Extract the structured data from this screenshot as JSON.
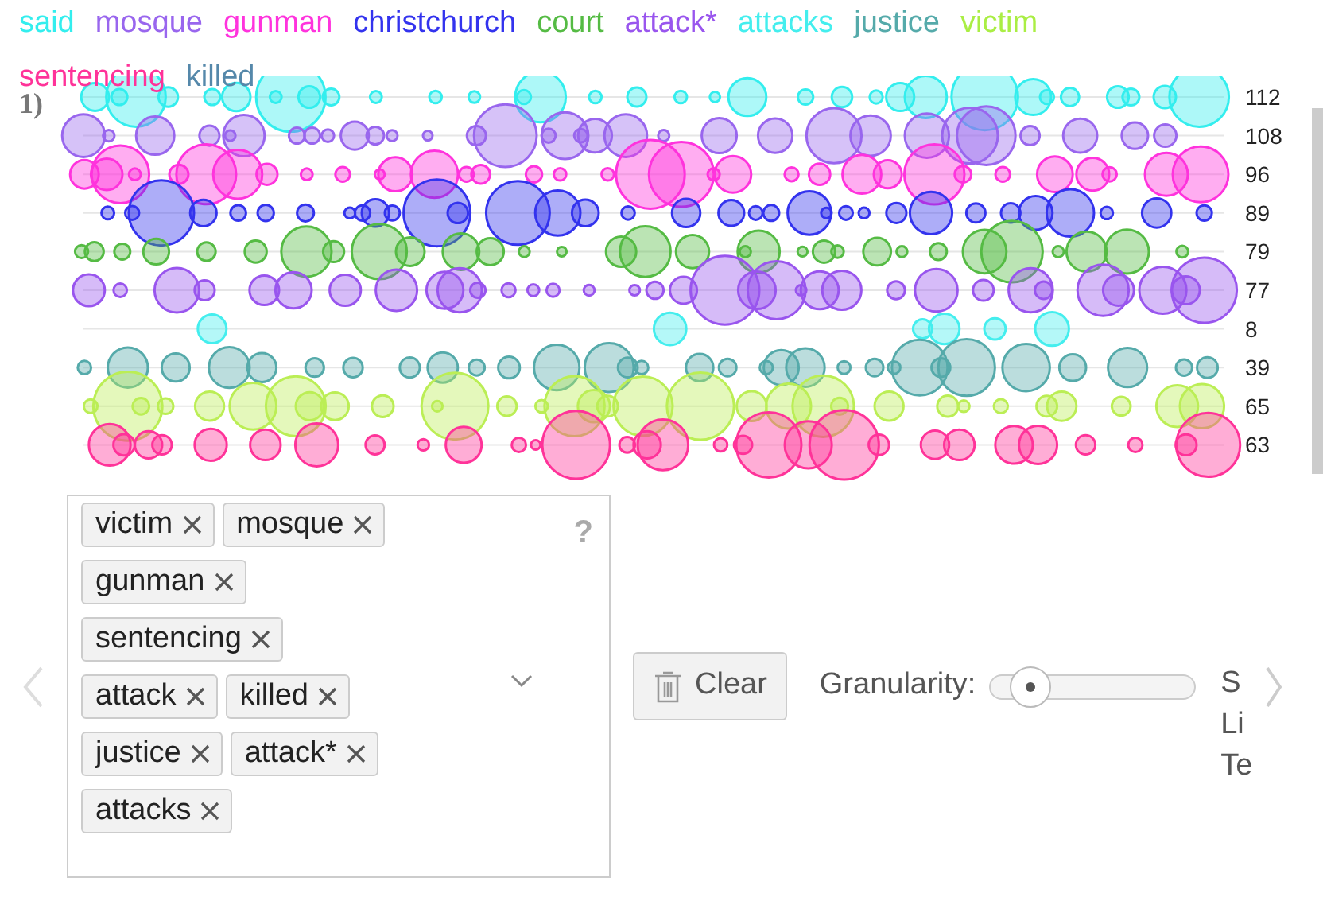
{
  "legend": [
    {
      "label": "said",
      "color": "#33eeee"
    },
    {
      "label": "mosque",
      "color": "#9966ee"
    },
    {
      "label": "gunman",
      "color": "#ff33dd"
    },
    {
      "label": "christchurch",
      "color": "#3333ee"
    },
    {
      "label": "court",
      "color": "#55bb44"
    },
    {
      "label": "attack*",
      "color": "#9955ee"
    },
    {
      "label": "attacks",
      "color": "#44eeee"
    },
    {
      "label": "justice",
      "color": "#55aaaa"
    },
    {
      "label": "victim",
      "color": "#aaee44"
    },
    {
      "label": "sentencing",
      "color": "#ff3399"
    },
    {
      "label": "killed",
      "color": "#5588aa"
    }
  ],
  "chart": {
    "index_label": "1)",
    "rows": [
      {
        "count": "112",
        "color": "#33eeee"
      },
      {
        "count": "108",
        "color": "#9966ee"
      },
      {
        "count": "96",
        "color": "#ff33dd"
      },
      {
        "count": "89",
        "color": "#3333ee"
      },
      {
        "count": "79",
        "color": "#55bb44"
      },
      {
        "count": "77",
        "color": "#9955ee"
      },
      {
        "count": "8",
        "color": "#44eeee"
      },
      {
        "count": "39",
        "color": "#55aaaa"
      },
      {
        "count": "65",
        "color": "#bbee55"
      },
      {
        "count": "63",
        "color": "#ff3399"
      }
    ]
  },
  "tags": [
    {
      "label": "victim"
    },
    {
      "label": "mosque"
    },
    {
      "label": "gunman"
    },
    {
      "label": "sentencing"
    },
    {
      "label": "attack"
    },
    {
      "label": "killed"
    },
    {
      "label": "justice"
    },
    {
      "label": "attack*"
    },
    {
      "label": "attacks"
    }
  ],
  "help": "?",
  "clear_button": "Clear",
  "granularity": {
    "label": "Granularity:",
    "level": 0.2
  },
  "side_texts": [
    "S",
    "Li",
    "Te"
  ]
}
